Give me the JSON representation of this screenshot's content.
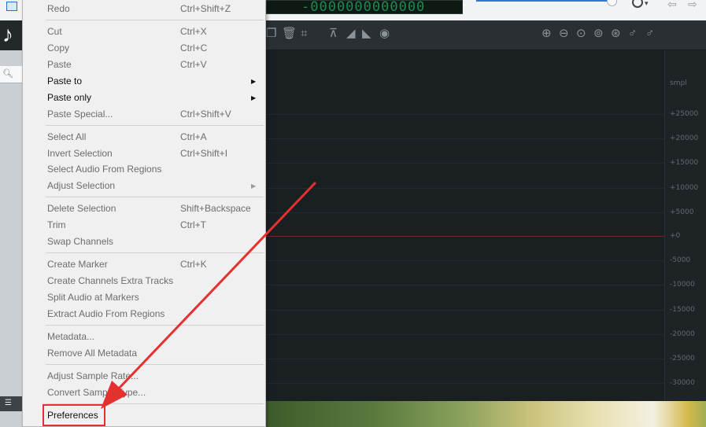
{
  "topbar": {
    "time_display": "-0000000000000"
  },
  "toolbar": {
    "icons": [
      "copy-icon",
      "trash-icon",
      "crop-icon",
      "align-icon",
      "fade-in-icon",
      "fade-out-icon",
      "normalize-icon",
      "zoom-in-icon",
      "zoom-out-icon",
      "zoom-selection-icon",
      "zoom-fit-icon",
      "zoom-full-icon",
      "zoom-vertical-in-icon",
      "zoom-vertical-out-icon"
    ]
  },
  "scale": {
    "unit": "smpl",
    "labels": [
      "+25000",
      "+20000",
      "+15000",
      "+10000",
      "+5000",
      "+0",
      "-5000",
      "-10000",
      "-15000",
      "-20000",
      "-25000",
      "-30000"
    ]
  },
  "menu": {
    "items": [
      {
        "label": "Redo",
        "shortcut": "Ctrl+Shift+Z",
        "enabled": false
      },
      {
        "label": "Cut",
        "shortcut": "Ctrl+X",
        "enabled": false
      },
      {
        "label": "Copy",
        "shortcut": "Ctrl+C",
        "enabled": false
      },
      {
        "label": "Paste",
        "shortcut": "Ctrl+V",
        "enabled": false
      },
      {
        "label": "Paste to",
        "shortcut": "",
        "enabled": true
      },
      {
        "label": "Paste only",
        "shortcut": "",
        "enabled": true
      },
      {
        "label": "Paste Special...",
        "shortcut": "Ctrl+Shift+V",
        "enabled": false
      },
      {
        "label": "Select All",
        "shortcut": "Ctrl+A",
        "enabled": false
      },
      {
        "label": "Invert Selection",
        "shortcut": "Ctrl+Shift+I",
        "enabled": false
      },
      {
        "label": "Select Audio From Regions",
        "shortcut": "",
        "enabled": false
      },
      {
        "label": "Adjust Selection",
        "shortcut": "",
        "enabled": false
      },
      {
        "label": "Delete Selection",
        "shortcut": "Shift+Backspace",
        "enabled": false
      },
      {
        "label": "Trim",
        "shortcut": "Ctrl+T",
        "enabled": false
      },
      {
        "label": "Swap Channels",
        "shortcut": "",
        "enabled": false
      },
      {
        "label": "Create Marker",
        "shortcut": "Ctrl+K",
        "enabled": false
      },
      {
        "label": "Create Channels Extra Tracks",
        "shortcut": "",
        "enabled": false
      },
      {
        "label": "Split Audio at Markers",
        "shortcut": "",
        "enabled": false
      },
      {
        "label": "Extract Audio From Regions",
        "shortcut": "",
        "enabled": false
      },
      {
        "label": "Metadata...",
        "shortcut": "",
        "enabled": false
      },
      {
        "label": "Remove All Metadata",
        "shortcut": "",
        "enabled": false
      },
      {
        "label": "Adjust Sample Rate...",
        "shortcut": "",
        "enabled": false
      },
      {
        "label": "Convert Sample Type...",
        "shortcut": "",
        "enabled": false
      },
      {
        "label": "Preferences",
        "shortcut": "",
        "enabled": true
      }
    ]
  },
  "colors": {
    "highlight": "#e53030",
    "arrow": "#e53030"
  }
}
